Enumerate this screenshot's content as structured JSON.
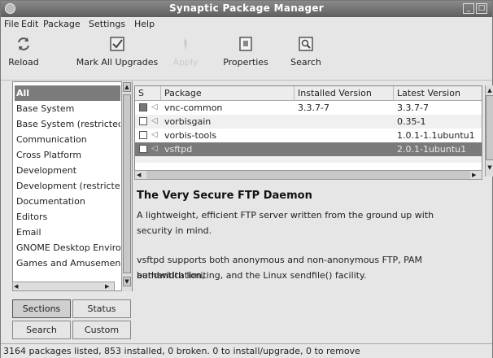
{
  "window": {
    "title": "Synaptic Package Manager"
  },
  "menu": [
    "File",
    "Edit",
    "Package",
    "Settings",
    "Help"
  ],
  "toolbar": {
    "reload": "Reload",
    "mark_all": "Mark All Upgrades",
    "apply": "Apply",
    "properties": "Properties",
    "search": "Search"
  },
  "sections": [
    "All",
    "Base System",
    "Base System (restricted)",
    "Communication",
    "Cross Platform",
    "Development",
    "Development (restricted)",
    "Documentation",
    "Editors",
    "Email",
    "GNOME Desktop Environment",
    "Games and Amusements"
  ],
  "filter_buttons": {
    "sections": "Sections",
    "status": "Status",
    "search": "Search",
    "custom": "Custom"
  },
  "table": {
    "headers": {
      "s": "S",
      "package": "Package",
      "installed": "Installed Version",
      "latest": "Latest Version"
    },
    "rows": [
      {
        "name": "vnc-common",
        "installed": "3.3.7-7",
        "latest": "3.3.7-7",
        "checked": true
      },
      {
        "name": "vorbisgain",
        "installed": "",
        "latest": "0.35-1",
        "checked": false
      },
      {
        "name": "vorbis-tools",
        "installed": "",
        "latest": "1.0.1-1.1ubuntu1",
        "checked": false
      },
      {
        "name": "vsftpd",
        "installed": "",
        "latest": "2.0.1-1ubuntu1",
        "checked": false,
        "selected": true
      }
    ]
  },
  "description": {
    "title": "The Very Secure FTP Daemon",
    "p1_line1": "A lightweight, efficient FTP server written from the ground up with",
    "p1_line2": "security in mind.",
    "p2_line1": "vsftpd supports both anonymous and non-anonymous FTP, PAM authentication,",
    "p2_line2": "bandwidth limiting, and the Linux sendfile() facility."
  },
  "status": "3164 packages listed, 853 installed, 0 broken. 0 to install/upgrade, 0 to remove"
}
